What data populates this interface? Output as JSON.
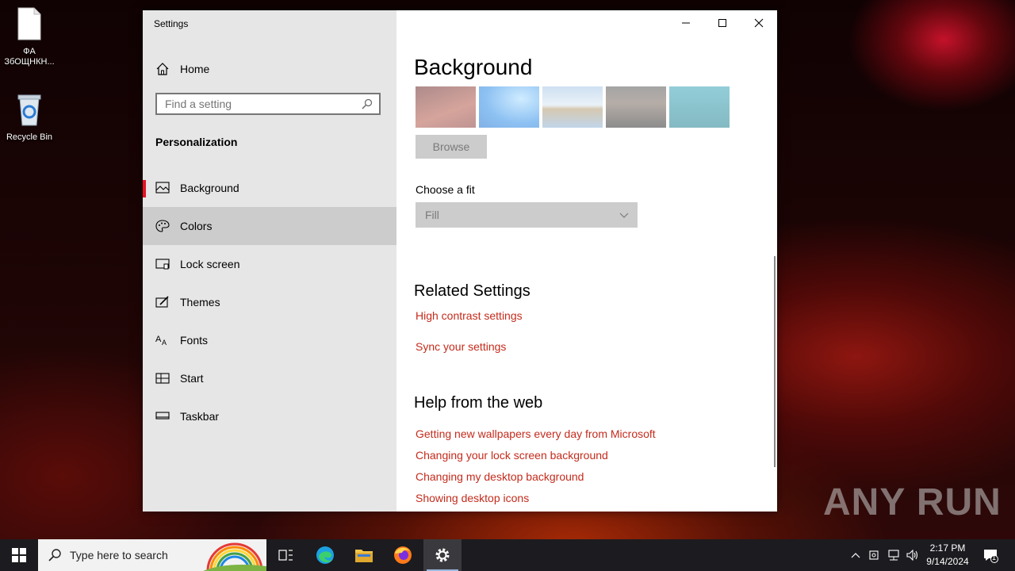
{
  "desktop": {
    "icons": [
      {
        "label": "ФA\nЗбОЩНКН..."
      },
      {
        "label": "Recycle Bin"
      }
    ],
    "watermark": "ANY RUN"
  },
  "window": {
    "title": "Settings",
    "nav": {
      "home": "Home",
      "search_placeholder": "Find a setting",
      "section": "Personalization",
      "items": [
        {
          "label": "Background",
          "icon": "image-icon",
          "active": true
        },
        {
          "label": "Colors",
          "icon": "palette-icon",
          "hover": true
        },
        {
          "label": "Lock screen",
          "icon": "lock-screen-icon"
        },
        {
          "label": "Themes",
          "icon": "themes-icon"
        },
        {
          "label": "Fonts",
          "icon": "fonts-icon"
        },
        {
          "label": "Start",
          "icon": "start-layout-icon"
        },
        {
          "label": "Taskbar",
          "icon": "taskbar-icon"
        }
      ]
    },
    "content": {
      "heading": "Background",
      "browse": "Browse",
      "fit_label": "Choose a fit",
      "fit_value": "Fill",
      "related_heading": "Related Settings",
      "related_links": [
        "High contrast settings",
        "Sync your settings"
      ],
      "help_heading": "Help from the web",
      "help_links": [
        "Getting new wallpapers every day from Microsoft",
        "Changing your lock screen background",
        "Changing my desktop background",
        "Showing desktop icons"
      ]
    }
  },
  "taskbar": {
    "search_placeholder": "Type here to search",
    "time": "2:17 PM",
    "date": "9/14/2024",
    "notification_count": "1"
  },
  "colors": {
    "accent": "#e81123",
    "link": "#c42b1c",
    "nav_bg": "#e6e6e6",
    "taskbar_bg": "#1c1b1f"
  }
}
